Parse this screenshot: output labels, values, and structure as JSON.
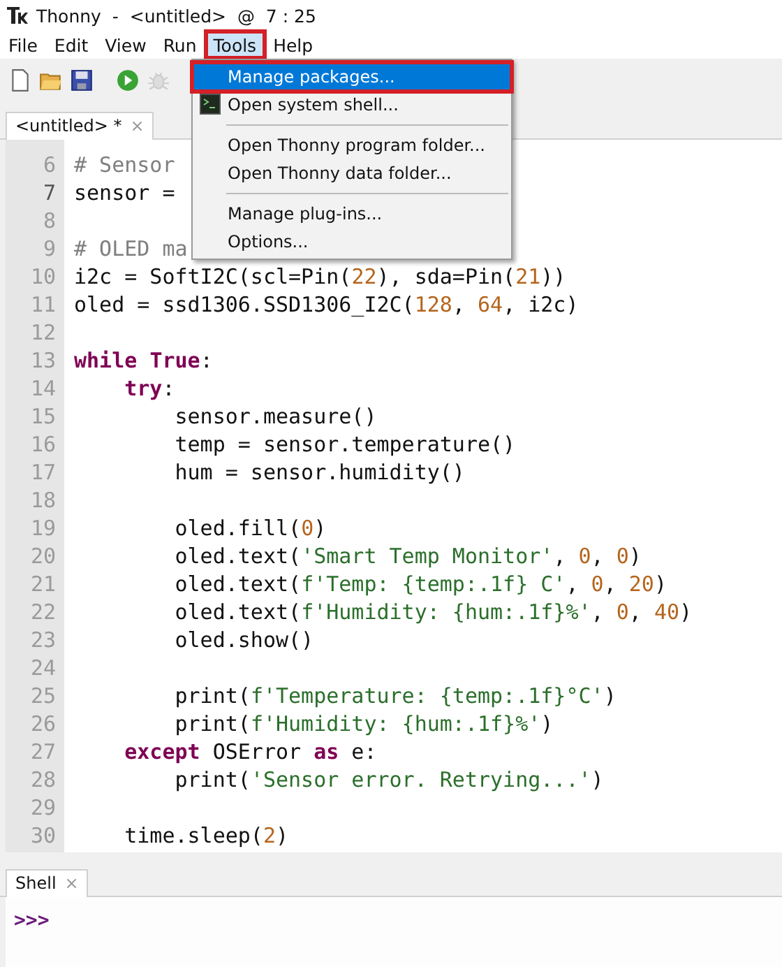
{
  "window": {
    "title": "Thonny  -  <untitled>  @  7 : 25"
  },
  "menubar": [
    {
      "label": "File",
      "selected": false,
      "annotated": false
    },
    {
      "label": "Edit",
      "selected": false,
      "annotated": false
    },
    {
      "label": "View",
      "selected": false,
      "annotated": false
    },
    {
      "label": "Run",
      "selected": false,
      "annotated": false
    },
    {
      "label": "Tools",
      "selected": true,
      "annotated": true
    },
    {
      "label": "Help",
      "selected": false,
      "annotated": false
    }
  ],
  "editor_tabs": [
    {
      "label": "<untitled> *",
      "close": "×",
      "selected": true
    }
  ],
  "editor_lines": [
    {
      "number": "6",
      "current": false,
      "tokens": [
        {
          "kind": "comment",
          "text": "# Sensor"
        }
      ]
    },
    {
      "number": "7",
      "current": true,
      "tokens": [
        {
          "kind": "plain",
          "text": "sensor ="
        }
      ]
    },
    {
      "number": "8",
      "current": false
    },
    {
      "number": "9",
      "current": false,
      "tokens": [
        {
          "kind": "comment",
          "text": "# OLED ma"
        }
      ]
    },
    {
      "number": "10",
      "current": false,
      "tokens": [
        {
          "kind": "plain",
          "text": "i2c = SoftI2C(scl=Pin("
        },
        {
          "kind": "number",
          "text": "22"
        },
        {
          "kind": "plain",
          "text": "), sda=Pin("
        },
        {
          "kind": "number",
          "text": "21"
        },
        {
          "kind": "plain",
          "text": "))"
        }
      ]
    },
    {
      "number": "11",
      "current": false,
      "tokens": [
        {
          "kind": "plain",
          "text": "oled = ssd1306.SSD1306_I2C("
        },
        {
          "kind": "number",
          "text": "128"
        },
        {
          "kind": "plain",
          "text": ", "
        },
        {
          "kind": "number",
          "text": "64"
        },
        {
          "kind": "plain",
          "text": ", i2c)"
        }
      ]
    },
    {
      "number": "12",
      "current": false
    },
    {
      "number": "13",
      "current": false,
      "tokens": [
        {
          "kind": "keyword",
          "text": "while "
        },
        {
          "kind": "keyword",
          "text": "True"
        },
        {
          "kind": "plain",
          "text": ":"
        }
      ]
    },
    {
      "number": "14",
      "current": false,
      "tokens": [
        {
          "kind": "keyword",
          "text": "    try"
        },
        {
          "kind": "plain",
          "text": ":"
        }
      ]
    },
    {
      "number": "15",
      "current": false,
      "tokens": [
        {
          "kind": "plain",
          "text": "        sensor.measure()"
        }
      ]
    },
    {
      "number": "16",
      "current": false,
      "tokens": [
        {
          "kind": "plain",
          "text": "        temp = sensor.temperature()"
        }
      ]
    },
    {
      "number": "17",
      "current": false,
      "tokens": [
        {
          "kind": "plain",
          "text": "        hum = sensor.humidity()"
        }
      ]
    },
    {
      "number": "18",
      "current": false
    },
    {
      "number": "19",
      "current": false,
      "tokens": [
        {
          "kind": "plain",
          "text": "        oled.fill("
        },
        {
          "kind": "number",
          "text": "0"
        },
        {
          "kind": "plain",
          "text": ")"
        }
      ]
    },
    {
      "number": "20",
      "current": false,
      "tokens": [
        {
          "kind": "plain",
          "text": "        oled.text("
        },
        {
          "kind": "string",
          "text": "'Smart Temp Monitor'"
        },
        {
          "kind": "plain",
          "text": ", "
        },
        {
          "kind": "number",
          "text": "0"
        },
        {
          "kind": "plain",
          "text": ", "
        },
        {
          "kind": "number",
          "text": "0"
        },
        {
          "kind": "plain",
          "text": ")"
        }
      ]
    },
    {
      "number": "21",
      "current": false,
      "tokens": [
        {
          "kind": "plain",
          "text": "        oled.text("
        },
        {
          "kind": "string",
          "text": "f'Temp: {temp:.1f} C'"
        },
        {
          "kind": "plain",
          "text": ", "
        },
        {
          "kind": "number",
          "text": "0"
        },
        {
          "kind": "plain",
          "text": ", "
        },
        {
          "kind": "number",
          "text": "20"
        },
        {
          "kind": "plain",
          "text": ")"
        }
      ]
    },
    {
      "number": "22",
      "current": false,
      "tokens": [
        {
          "kind": "plain",
          "text": "        oled.text("
        },
        {
          "kind": "string",
          "text": "f'Humidity: {hum:.1f}%'"
        },
        {
          "kind": "plain",
          "text": ", "
        },
        {
          "kind": "number",
          "text": "0"
        },
        {
          "kind": "plain",
          "text": ", "
        },
        {
          "kind": "number",
          "text": "40"
        },
        {
          "kind": "plain",
          "text": ")"
        }
      ]
    },
    {
      "number": "23",
      "current": false,
      "tokens": [
        {
          "kind": "plain",
          "text": "        oled.show()"
        }
      ]
    },
    {
      "number": "24",
      "current": false
    },
    {
      "number": "25",
      "current": false,
      "tokens": [
        {
          "kind": "plain",
          "text": "        print("
        },
        {
          "kind": "string",
          "text": "f'Temperature: {temp:.1f}°C'"
        },
        {
          "kind": "plain",
          "text": ")"
        }
      ]
    },
    {
      "number": "26",
      "current": false,
      "tokens": [
        {
          "kind": "plain",
          "text": "        print("
        },
        {
          "kind": "string",
          "text": "f'Humidity: {hum:.1f}%'"
        },
        {
          "kind": "plain",
          "text": ")"
        }
      ]
    },
    {
      "number": "27",
      "current": false,
      "tokens": [
        {
          "kind": "keyword",
          "text": "    except"
        },
        {
          "kind": "plain",
          "text": " OSError "
        },
        {
          "kind": "keyword",
          "text": "as"
        },
        {
          "kind": "plain",
          "text": " e:"
        }
      ]
    },
    {
      "number": "28",
      "current": false,
      "tokens": [
        {
          "kind": "plain",
          "text": "        print("
        },
        {
          "kind": "string",
          "text": "'Sensor error. Retrying...'"
        },
        {
          "kind": "plain",
          "text": ")"
        }
      ]
    },
    {
      "number": "29",
      "current": false
    },
    {
      "number": "30",
      "current": false,
      "tokens": [
        {
          "kind": "plain",
          "text": "    time.sleep("
        },
        {
          "kind": "number",
          "text": "2"
        },
        {
          "kind": "plain",
          "text": ")"
        }
      ]
    }
  ],
  "tools_menu": [
    {
      "kind": "item",
      "label": "Manage packages...",
      "selected": true,
      "annotated": true
    },
    {
      "kind": "icon-item",
      "label": "Open system shell...",
      "selected": false,
      "annotated": false
    },
    {
      "kind": "separator"
    },
    {
      "kind": "item",
      "label": "Open Thonny program folder...",
      "selected": false,
      "annotated": false
    },
    {
      "kind": "item",
      "label": "Open Thonny data folder...",
      "selected": false,
      "annotated": false
    },
    {
      "kind": "separator"
    },
    {
      "kind": "item",
      "label": "Manage plug-ins...",
      "selected": false,
      "annotated": false
    },
    {
      "kind": "item",
      "label": "Options...",
      "selected": false,
      "annotated": false
    }
  ],
  "shell_tabs": [
    {
      "label": "Shell",
      "close": "×",
      "selected": true
    }
  ],
  "shell": {
    "prompt": ">>>"
  }
}
